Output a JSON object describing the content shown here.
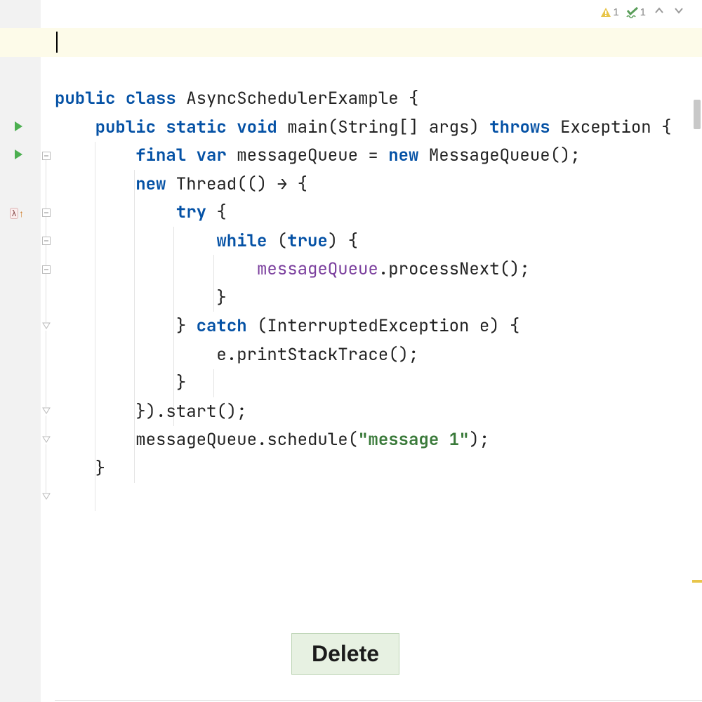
{
  "inspection": {
    "warning_count": "1",
    "typo_count": "1"
  },
  "code": {
    "blank": "",
    "l1": {
      "kw1": "public",
      "kw2": "class",
      "cls": "AsyncSchedulerExample",
      "tail": " {"
    },
    "l2": {
      "ind": "    ",
      "kw1": "public",
      "kw2": "static",
      "kw3": "void",
      "m": "main(String[] args)",
      "kw4": "throws",
      "ex": "Exception {"
    },
    "l3": {
      "ind": "        ",
      "kw1": "final",
      "kw2": "var",
      "txt1": " messageQueue = ",
      "kw3": "new",
      "txt2": " MessageQueue();"
    },
    "l4": {
      "ind": "        ",
      "kw1": "new",
      "txt": " Thread(() → {"
    },
    "l5": {
      "ind": "            ",
      "kw1": "try",
      "txt": " {"
    },
    "l6": {
      "ind": "                ",
      "kw1": "while",
      "txt1": " (",
      "kw2": "true",
      "txt2": ") {"
    },
    "l7": {
      "ind": "                    ",
      "field": "messageQueue",
      "txt": ".processNext();"
    },
    "l8": {
      "ind": "                ",
      "txt": "}"
    },
    "l9": {
      "ind": "            ",
      "txt1": "} ",
      "kw1": "catch",
      "txt2": " (InterruptedException e) {"
    },
    "l10": {
      "ind": "                ",
      "txt": "e.printStackTrace();"
    },
    "l11": {
      "ind": "            ",
      "txt": "}"
    },
    "l12": {
      "ind": "        ",
      "txt": "}).start();"
    },
    "l13": {
      "ind": "        ",
      "txt1": "messageQueue.schedule(",
      "str": "\"message 1\"",
      "txt2": ");"
    },
    "l14": {
      "ind": "    ",
      "txt": "}"
    }
  },
  "button": {
    "delete": "Delete"
  }
}
